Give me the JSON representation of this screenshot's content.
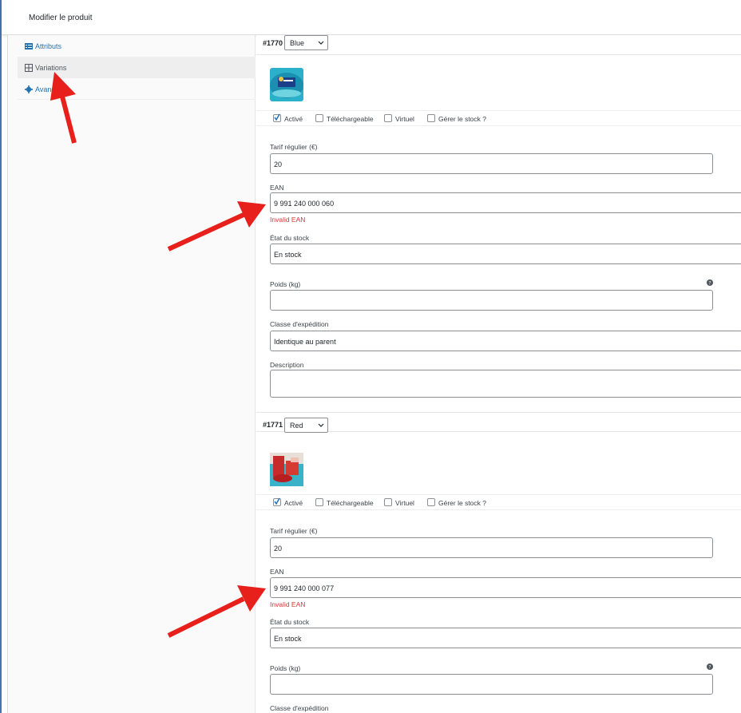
{
  "window": {
    "title": "Modifier le produit"
  },
  "sidebar": {
    "tabs": [
      {
        "label": "Attributs"
      },
      {
        "label": "Variations"
      },
      {
        "label": "Avancé"
      }
    ]
  },
  "variations": [
    {
      "id": "#1770",
      "attribute_value": "Blue",
      "checks": {
        "active": "Activé",
        "downloadable": "Téléchargeable",
        "virtual": "Virtuel",
        "manage_stock": "Gérer le stock ?"
      },
      "price_label": "Tarif régulier (€)",
      "price_value": "20",
      "ean_label": "EAN",
      "ean_value": "9 991 240 000 060",
      "ean_error": "Invalid EAN",
      "stock_label": "État du stock",
      "stock_value": "En stock",
      "weight_label": "Poids (kg)",
      "shipping_label": "Classe d'expédition",
      "shipping_value": "Identique au parent",
      "description_label": "Description"
    },
    {
      "id": "#1771",
      "attribute_value": "Red",
      "checks": {
        "active": "Activé",
        "downloadable": "Téléchargeable",
        "virtual": "Virtuel",
        "manage_stock": "Gérer le stock ?"
      },
      "price_label": "Tarif régulier (€)",
      "price_value": "20",
      "ean_label": "EAN",
      "ean_value": "9 991 240 000 077",
      "ean_error": "Invalid EAN",
      "stock_label": "État du stock",
      "stock_value": "En stock",
      "weight_label": "Poids (kg)",
      "shipping_label": "Classe d'expédition"
    }
  ],
  "colors": {
    "link": "#2271b1",
    "error": "#d63638",
    "annotation_arrow": "#e8201b",
    "frame_border": "#4a6fb5"
  }
}
